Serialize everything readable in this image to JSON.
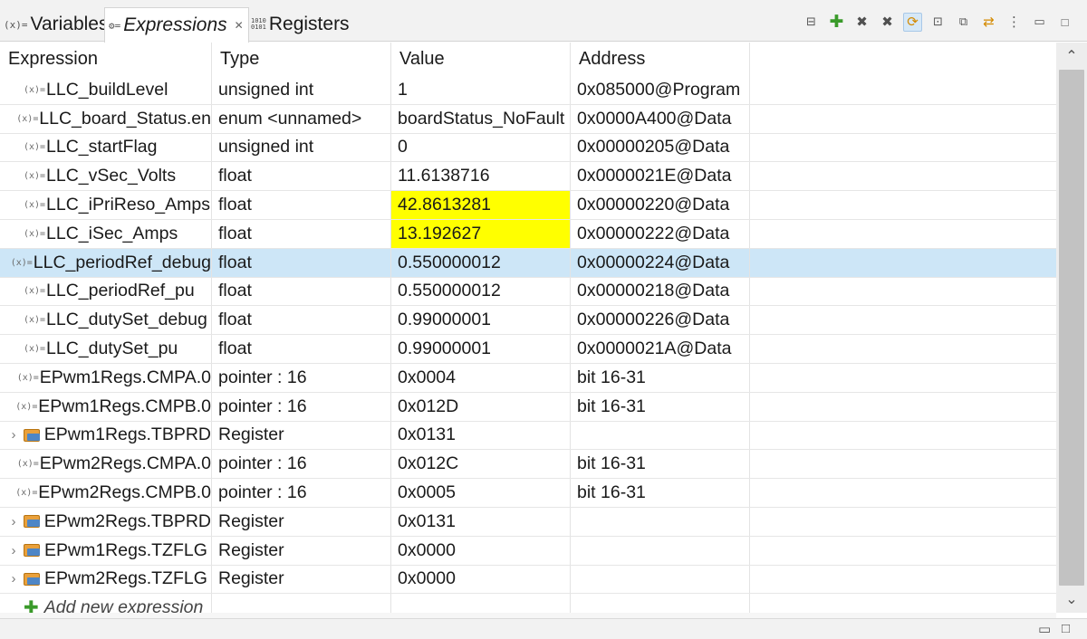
{
  "tabs": [
    {
      "icon": "(x)=",
      "label": "Variables"
    },
    {
      "icon": "⚙=",
      "label": "Expressions",
      "close": "✕"
    },
    {
      "icon": "0101",
      "label": "Registers"
    }
  ],
  "toolbar_icons": [
    "collapse-all-icon",
    "add-expression-icon",
    "remove-icon",
    "remove-all-icon",
    "refresh-icon",
    "new-view-icon",
    "pin-icon",
    "sync-icon",
    "view-menu-icon",
    "minimize-icon",
    "maximize-icon"
  ],
  "columns": {
    "expression": "Expression",
    "type": "Type",
    "value": "Value",
    "address": "Address"
  },
  "rows": [
    {
      "kind": "var",
      "expression": "LLC_buildLevel",
      "type": "unsigned int",
      "value": "1",
      "address": "0x085000@Program"
    },
    {
      "kind": "var",
      "expression": "LLC_board_Status.en",
      "type": "enum <unnamed>",
      "value": "boardStatus_NoFault",
      "address": "0x0000A400@Data"
    },
    {
      "kind": "var",
      "expression": "LLC_startFlag",
      "type": "unsigned int",
      "value": "0",
      "address": "0x00000205@Data"
    },
    {
      "kind": "var",
      "expression": "LLC_vSec_Volts",
      "type": "float",
      "value": "11.6138716",
      "address": "0x0000021E@Data"
    },
    {
      "kind": "var",
      "expression": "LLC_iPriReso_Amps",
      "type": "float",
      "value": "42.8613281",
      "address": "0x00000220@Data",
      "changed": true
    },
    {
      "kind": "var",
      "expression": "LLC_iSec_Amps",
      "type": "float",
      "value": "13.192627",
      "address": "0x00000222@Data",
      "changed": true
    },
    {
      "kind": "var",
      "expression": "LLC_periodRef_debug",
      "type": "float",
      "value": "0.550000012",
      "address": "0x00000224@Data",
      "selected": true
    },
    {
      "kind": "var",
      "expression": "LLC_periodRef_pu",
      "type": "float",
      "value": "0.550000012",
      "address": "0x00000218@Data"
    },
    {
      "kind": "var",
      "expression": "LLC_dutySet_debug",
      "type": "float",
      "value": "0.99000001",
      "address": "0x00000226@Data"
    },
    {
      "kind": "var",
      "expression": "LLC_dutySet_pu",
      "type": "float",
      "value": "0.99000001",
      "address": "0x0000021A@Data"
    },
    {
      "kind": "var",
      "expression": "EPwm1Regs.CMPA.0",
      "type": "pointer : 16",
      "value": "0x0004",
      "address": " bit 16-31"
    },
    {
      "kind": "var",
      "expression": "EPwm1Regs.CMPB.0",
      "type": "pointer : 16",
      "value": "0x012D",
      "address": " bit 16-31"
    },
    {
      "kind": "reg",
      "expression": "EPwm1Regs.TBPRD",
      "type": "Register",
      "value": "0x0131",
      "address": ""
    },
    {
      "kind": "var",
      "expression": "EPwm2Regs.CMPA.0",
      "type": "pointer : 16",
      "value": "0x012C",
      "address": " bit 16-31"
    },
    {
      "kind": "var",
      "expression": "EPwm2Regs.CMPB.0",
      "type": "pointer : 16",
      "value": "0x0005",
      "address": " bit 16-31"
    },
    {
      "kind": "reg",
      "expression": "EPwm2Regs.TBPRD",
      "type": "Register",
      "value": "0x0131",
      "address": ""
    },
    {
      "kind": "reg",
      "expression": "EPwm1Regs.TZFLG",
      "type": "Register",
      "value": "0x0000",
      "address": ""
    },
    {
      "kind": "reg",
      "expression": "EPwm2Regs.TZFLG",
      "type": "Register",
      "value": "0x0000",
      "address": ""
    }
  ],
  "add_row_label": "Add new expression",
  "icons": {
    "variable": "(x)=",
    "twisty": "›",
    "plus": "✚"
  }
}
